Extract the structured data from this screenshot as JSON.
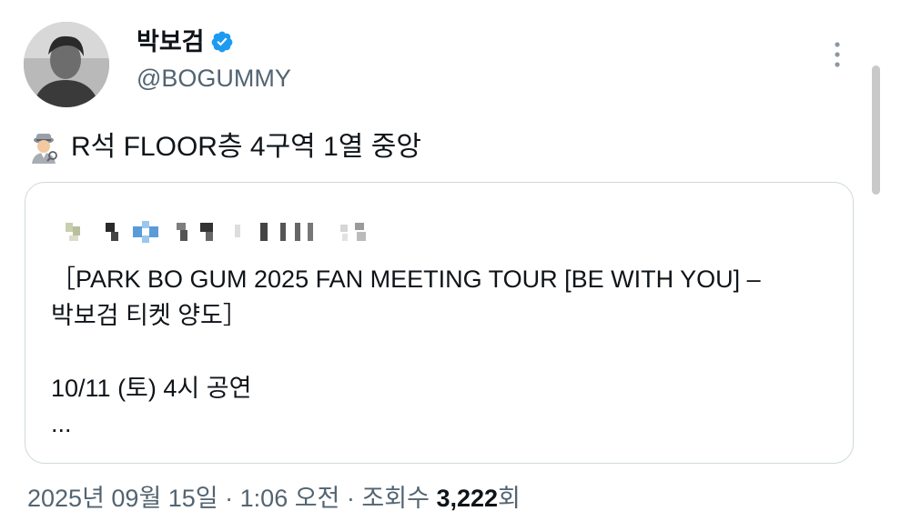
{
  "author": {
    "display_name": "박보검",
    "handle": "@BOGUMMY",
    "verified_color": "#1d9bf0"
  },
  "tweet": {
    "emoji": "detective-emoji",
    "text": "R석 FLOOR층 4구역 1열 중앙"
  },
  "quote": {
    "title": "［PARK BO GUM 2025 FAN MEETING TOUR [BE WITH YOU] –\n박보검 티켓 양도］",
    "date_line": "10/11 (토) 4시 공연",
    "ellipsis": "..."
  },
  "meta": {
    "date": "2025년 09월 15일",
    "time": "1:06 오전",
    "views_label": "조회수",
    "views_count": "3,222",
    "views_suffix": "회",
    "separator": " · "
  },
  "colors": {
    "text": "#0f1419",
    "secondary": "#536471",
    "border": "#cfd9de"
  }
}
